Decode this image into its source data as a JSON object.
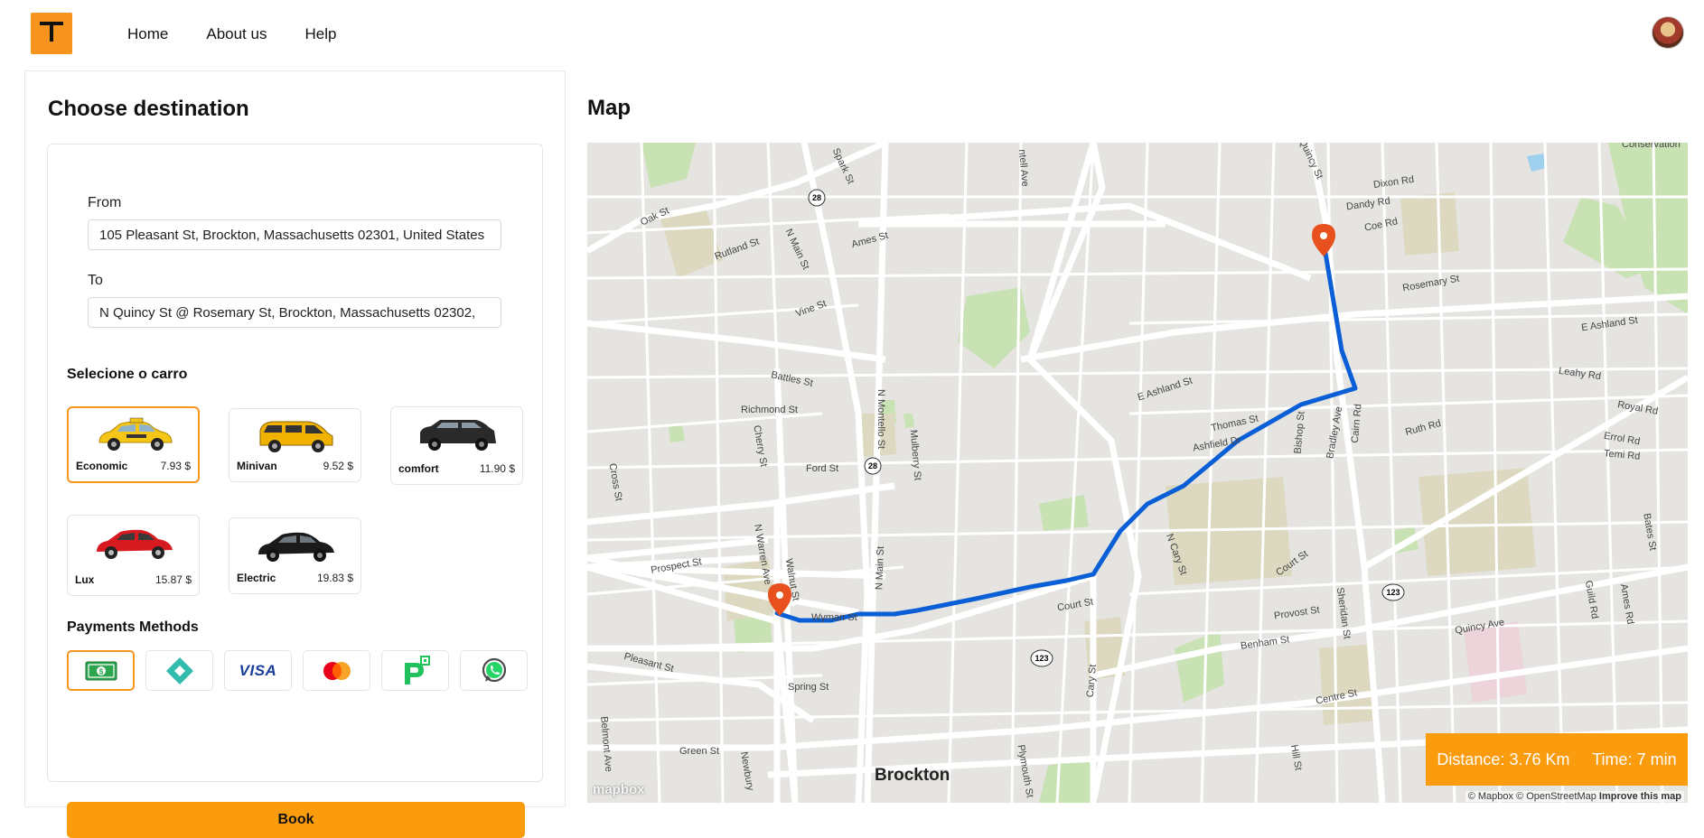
{
  "nav": {
    "items": [
      "Home",
      "About us",
      "Help"
    ]
  },
  "left": {
    "title": "Choose destination",
    "from_label": "From",
    "from_value": "105 Pleasant St, Brockton, Massachusetts 02301, United States",
    "to_label": "To",
    "to_value": "N Quincy St @ Rosemary St, Brockton, Massachusetts 02302,",
    "car_section": "Selecione o carro",
    "cars": [
      {
        "name": "Economic",
        "price": "7.93 $",
        "color": "#f5c518"
      },
      {
        "name": "Minivan",
        "price": "9.52 $",
        "color": "#f0b100"
      },
      {
        "name": "comfort",
        "price": "11.90 $",
        "color": "#2a2a2a"
      },
      {
        "name": "Lux",
        "price": "15.87 $",
        "color": "#d71920"
      },
      {
        "name": "Electric",
        "price": "19.83 $",
        "color": "#1a1a1a"
      }
    ],
    "payments_title": "Payments Methods",
    "payments": [
      "cash-icon",
      "pix-icon",
      "visa-icon",
      "mastercard-icon",
      "picpay-icon",
      "whatsapp-icon"
    ],
    "visa_text": "VISA",
    "book_label": "Book"
  },
  "map": {
    "title": "Map",
    "city": "Brockton",
    "distance_label": "Distance:",
    "distance_value": "3.76 Km",
    "time_label": "Time:",
    "time_value": "7 min",
    "attribution": "© Mapbox © OpenStreetMap",
    "improve": "Improve this map",
    "logo": "mapbox",
    "streets": [
      "Oak St",
      "Rutland St",
      "N Main St",
      "Spark St",
      "Ames St",
      "Vine St",
      "Battles St",
      "Richmond St",
      "Cherry St",
      "Ford St",
      "Cross St",
      "N Montello St",
      "Mulberry St",
      "Prospect St",
      "N Warren Ave",
      "Walnut St",
      "Wyman St",
      "N Main St",
      "Pleasant St",
      "Spring St",
      "Green St",
      "Belmont Ave",
      "Newbury",
      "Plymouth St",
      "E Ashland St",
      "Thomas St",
      "Ashfield Dr",
      "Bishop St",
      "Bradley Ave",
      "Cairn Rd",
      "Ruth Rd",
      "N Cary St",
      "Court St",
      "Court St",
      "Cary St",
      "Provost St",
      "Benham St",
      "Sheridan St",
      "Centre St",
      "Hill St",
      "Quincy Ave",
      "Guild Rd",
      "Ames Rd",
      "Bates St",
      "Errol Rd",
      "Temi Rd",
      "Royal Rd",
      "Leahy Rd",
      "E Ashland St",
      "Rosemary St",
      "Coe Rd",
      "Dandy Rd",
      "Dixon Rd",
      "Quincy St",
      "Conservation",
      "ntell Ave"
    ],
    "route_shields": [
      "28",
      "28",
      "123",
      "123"
    ]
  },
  "colors": {
    "accent": "#fb9b0e",
    "route": "#0b5fd6",
    "marker": "#e8501d"
  }
}
